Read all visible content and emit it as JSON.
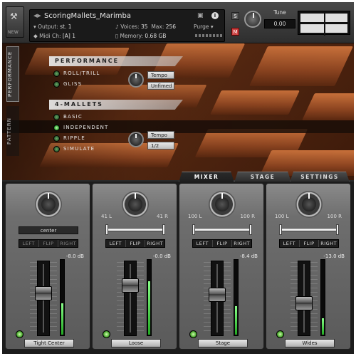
{
  "header": {
    "tool_label": "NEW",
    "instrument": "ScoringMallets_Marimba",
    "output_label": "Output:",
    "output_value": "st. 1",
    "midi_label": "Midi Ch:",
    "midi_value": "[A]  1",
    "voices_label": "Voices:",
    "voices_value": "35",
    "max_label": "Max:",
    "max_value": "256",
    "memory_label": "Memory:",
    "memory_value": "0.68 GB",
    "purge_label": "Purge",
    "solo_label": "S",
    "mute_label": "M",
    "tune_label": "Tune",
    "tune_value": "0.00"
  },
  "side_tabs": {
    "performance": "PERFORMANCE",
    "pattern": "PATTERN"
  },
  "performance": {
    "title": "PERFORMANCE",
    "options": [
      {
        "label": "ROLL/TRILL",
        "on": false
      },
      {
        "label": "GLISS",
        "on": false
      }
    ],
    "pill1": "Tempo",
    "pill2": "Unfimed"
  },
  "four_mallets": {
    "title": "4-MALLETS",
    "options": [
      {
        "label": "BASIC",
        "on": false
      },
      {
        "label": "INDEPENDENT",
        "on": true
      },
      {
        "label": "RIPPLE",
        "on": false
      },
      {
        "label": "SIMULATE",
        "on": false
      }
    ],
    "pill1": "Tempo",
    "pill2": "1/2"
  },
  "tabs": {
    "mixer": "MIXER",
    "stage": "STAGE",
    "settings": "SETTINGS",
    "active": "mixer"
  },
  "channels": [
    {
      "name": "Tight Center",
      "pan_left": "",
      "pan_right": "",
      "center": "center",
      "lfr": [
        "LEFT",
        "FLIP",
        "RIGHT"
      ],
      "db": "-8.0 dB",
      "level": 0.42,
      "fader": 0.6
    },
    {
      "name": "Loose",
      "pan_left": "41 L",
      "pan_right": "41 R",
      "center": "",
      "lfr": [
        "LEFT",
        "FLIP",
        "RIGHT"
      ],
      "db": "-0.0 dB",
      "level": 0.72,
      "fader": 0.72
    },
    {
      "name": "Stage",
      "pan_left": "100 L",
      "pan_right": "100 R",
      "center": "",
      "lfr": [
        "LEFT",
        "FLIP",
        "RIGHT"
      ],
      "db": "-8.4 dB",
      "level": 0.38,
      "fader": 0.58
    },
    {
      "name": "Wides",
      "pan_left": "100 L",
      "pan_right": "100 R",
      "center": "",
      "lfr": [
        "LEFT",
        "FLIP",
        "RIGHT"
      ],
      "db": "-13.0 dB",
      "level": 0.22,
      "fader": 0.45
    }
  ]
}
